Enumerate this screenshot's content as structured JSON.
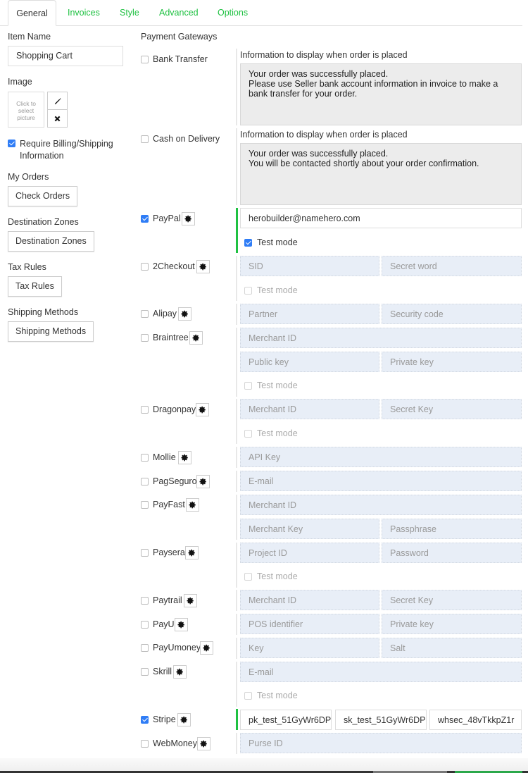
{
  "tabs": [
    {
      "label": "General",
      "active": true
    },
    {
      "label": "Invoices"
    },
    {
      "label": "Style"
    },
    {
      "label": "Advanced"
    },
    {
      "label": "Options"
    }
  ],
  "left": {
    "item_name_label": "Item Name",
    "item_name_value": "Shopping Cart",
    "image_label": "Image",
    "image_placeholder": "Click to select picture",
    "require_billing_label": "Require Billing/Shipping Information",
    "require_billing_checked": true,
    "my_orders_label": "My Orders",
    "check_orders_button": "Check Orders",
    "destination_zones_label": "Destination Zones",
    "destination_zones_button": "Destination Zones",
    "tax_rules_label": "Tax Rules",
    "tax_rules_button": "Tax Rules",
    "shipping_methods_label": "Shipping Methods",
    "shipping_methods_button": "Shipping Methods"
  },
  "payment": {
    "title": "Payment Gateways",
    "info_label": "Information to display when order is placed",
    "test_mode_label": "Test mode",
    "accent_color": "#1fc142",
    "gateways": [
      {
        "name": "Bank Transfer",
        "checked": false,
        "info": "Your order was successfully placed.\nPlease use Seller bank account information in invoice to make a bank transfer for your order."
      },
      {
        "name": "Cash on Delivery",
        "checked": false,
        "info": "Your order was successfully placed.\nYou will be contacted shortly about your order confirmation."
      },
      {
        "name": "PayPal",
        "checked": true,
        "fields": [
          {
            "value": "herobuilder@namehero.com"
          }
        ],
        "test_mode": true
      },
      {
        "name": "2Checkout",
        "checked": false,
        "fields": [
          {
            "placeholder": "SID"
          },
          {
            "placeholder": "Secret word"
          }
        ],
        "test_mode": false
      },
      {
        "name": "Alipay",
        "checked": false,
        "fields": [
          {
            "placeholder": "Partner"
          },
          {
            "placeholder": "Security code"
          }
        ]
      },
      {
        "name": "Braintree",
        "checked": false,
        "fields": [
          {
            "placeholder": "Merchant ID"
          },
          {
            "placeholder": "Public key"
          },
          {
            "placeholder": "Private key"
          }
        ],
        "test_mode": false
      },
      {
        "name": "Dragonpay",
        "checked": false,
        "fields": [
          {
            "placeholder": "Merchant ID"
          },
          {
            "placeholder": "Secret Key"
          }
        ],
        "test_mode": false
      },
      {
        "name": "Mollie",
        "checked": false,
        "fields": [
          {
            "placeholder": "API Key"
          }
        ]
      },
      {
        "name": "PagSeguro",
        "checked": false,
        "fields": [
          {
            "placeholder": "E-mail"
          }
        ]
      },
      {
        "name": "PayFast",
        "checked": false,
        "fields": [
          {
            "placeholder": "Merchant ID"
          },
          {
            "placeholder": "Merchant Key"
          },
          {
            "placeholder": "Passphrase"
          }
        ]
      },
      {
        "name": "Paysera",
        "checked": false,
        "fields": [
          {
            "placeholder": "Project ID"
          },
          {
            "placeholder": "Password"
          }
        ],
        "test_mode": false
      },
      {
        "name": "Paytrail",
        "checked": false,
        "fields": [
          {
            "placeholder": "Merchant ID"
          },
          {
            "placeholder": "Secret Key"
          }
        ]
      },
      {
        "name": "PayU",
        "checked": false,
        "fields": [
          {
            "placeholder": "POS identifier"
          },
          {
            "placeholder": "Private key"
          }
        ]
      },
      {
        "name": "PayUmoney",
        "checked": false,
        "fields": [
          {
            "placeholder": "Key"
          },
          {
            "placeholder": "Salt"
          }
        ]
      },
      {
        "name": "Skrill",
        "checked": false,
        "fields": [
          {
            "placeholder": "E-mail"
          }
        ],
        "test_mode": false
      },
      {
        "name": "Stripe",
        "checked": true,
        "fields": [
          {
            "value": "pk_test_51GyWr6DP"
          },
          {
            "value": "sk_test_51GyWr6DP"
          },
          {
            "value": "whsec_48vTkkpZ1r"
          }
        ]
      },
      {
        "name": "WebMoney",
        "checked": false,
        "fields": [
          {
            "placeholder": "Purse ID"
          }
        ]
      }
    ]
  }
}
